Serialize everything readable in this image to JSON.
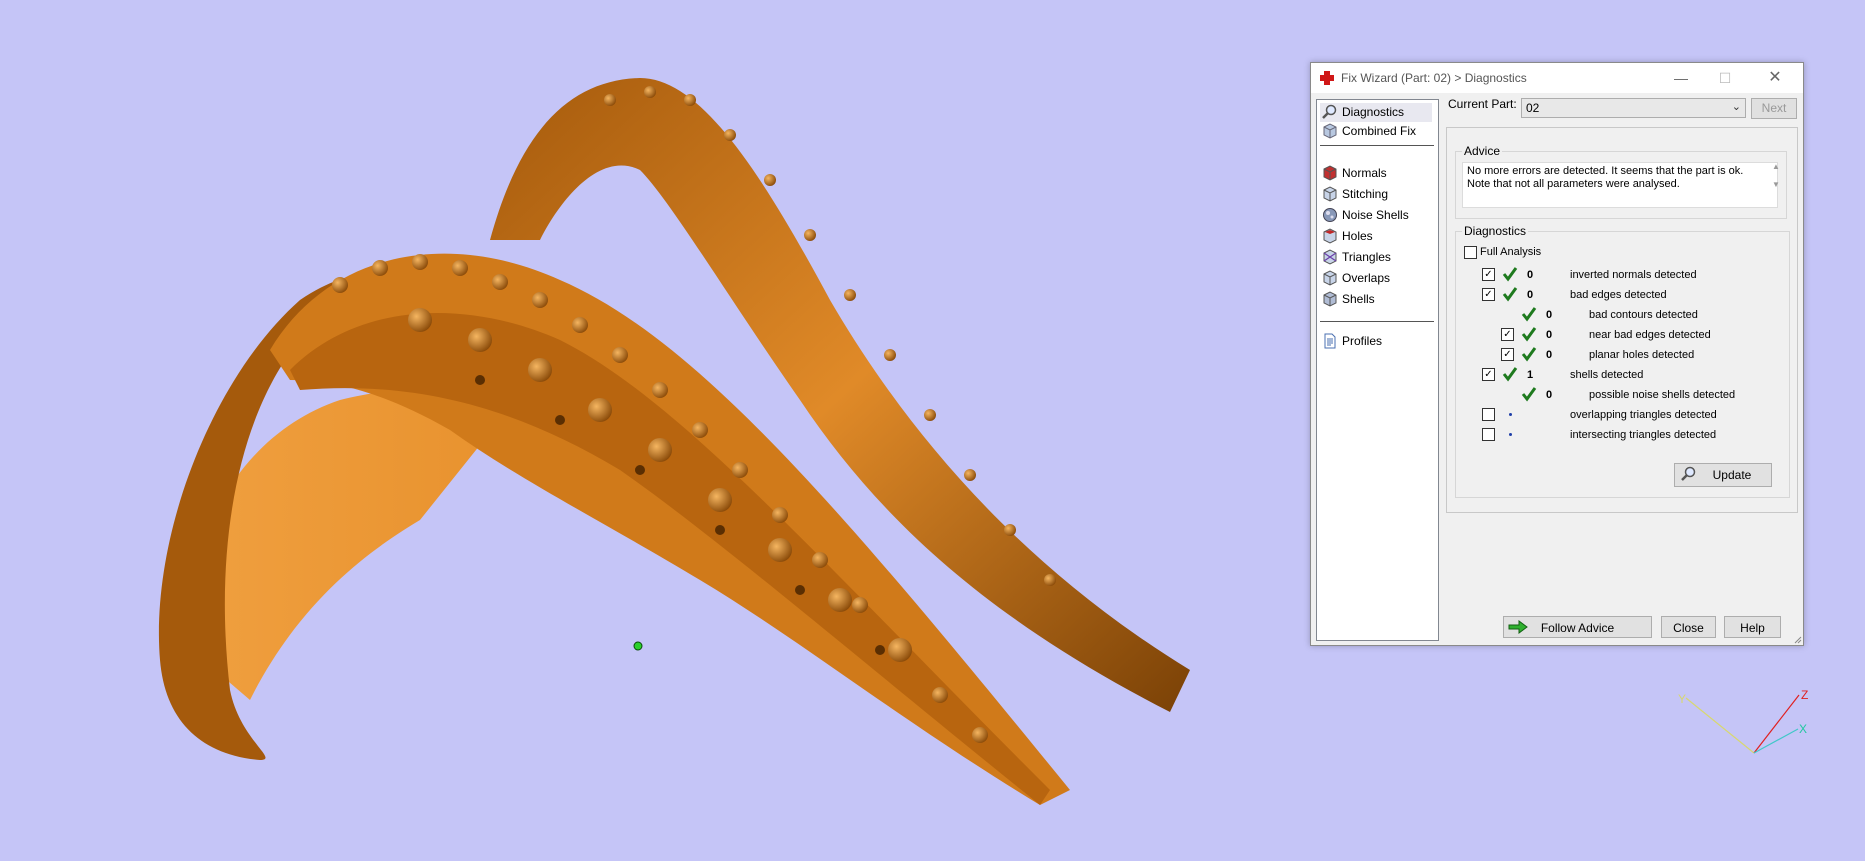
{
  "window": {
    "title": "Fix Wizard (Part: 02) > Diagnostics"
  },
  "nav": {
    "group1": [
      "Diagnostics",
      "Combined Fix"
    ],
    "group2": [
      "Normals",
      "Stitching",
      "Noise Shells",
      "Holes",
      "Triangles",
      "Overlaps",
      "Shells"
    ],
    "group3": [
      "Profiles"
    ],
    "active": "Diagnostics"
  },
  "current_part": {
    "label": "Current Part:",
    "value": "02",
    "next_label": "Next"
  },
  "advice": {
    "title": "Advice",
    "line1": "No more errors are detected. It seems that the part is ok.",
    "line2": "Note that not all parameters were analysed."
  },
  "diagnostics": {
    "title": "Diagnostics",
    "full_analysis": "Full Analysis",
    "rows": [
      {
        "checkbox": true,
        "checked": true,
        "status": "ok",
        "count": "0",
        "label": "inverted normals detected",
        "indent": 0
      },
      {
        "checkbox": true,
        "checked": true,
        "status": "ok",
        "count": "0",
        "label": "bad edges detected",
        "indent": 0
      },
      {
        "checkbox": false,
        "checked": false,
        "status": "ok",
        "count": "0",
        "label": "bad contours detected",
        "indent": 1
      },
      {
        "checkbox": true,
        "checked": true,
        "status": "ok",
        "count": "0",
        "label": "near bad edges detected",
        "indent": 1
      },
      {
        "checkbox": true,
        "checked": true,
        "status": "ok",
        "count": "0",
        "label": "planar holes detected",
        "indent": 1
      },
      {
        "checkbox": true,
        "checked": true,
        "status": "ok",
        "count": "1",
        "label": "shells detected",
        "indent": 0
      },
      {
        "checkbox": false,
        "checked": false,
        "status": "ok",
        "count": "0",
        "label": "possible noise shells detected",
        "indent": 1
      },
      {
        "checkbox": true,
        "checked": false,
        "status": "none",
        "count": "",
        "label": "overlapping triangles detected",
        "indent": 0
      },
      {
        "checkbox": true,
        "checked": false,
        "status": "none",
        "count": "",
        "label": "intersecting triangles detected",
        "indent": 0
      }
    ],
    "update_label": "Update"
  },
  "buttons": {
    "follow_advice": "Follow Advice",
    "close": "Close",
    "help": "Help"
  },
  "axis": {
    "y": "Y",
    "z": "Z",
    "x": "X"
  },
  "colors": {
    "background": "#c5c5f7",
    "model": "#d9821e",
    "check_green": "#1e7a1e"
  }
}
